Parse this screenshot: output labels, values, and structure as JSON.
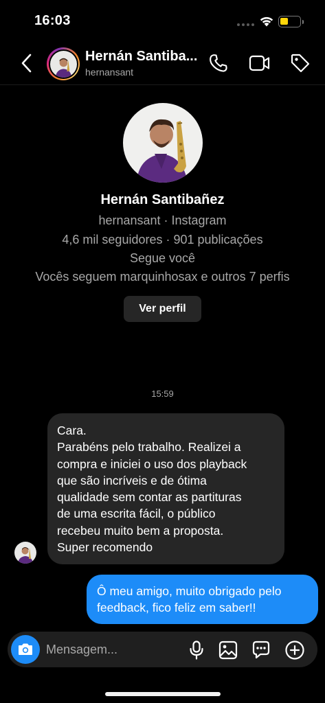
{
  "status_bar": {
    "time": "16:03",
    "battery_color": "#ffd60a"
  },
  "header": {
    "name": "Hernán Santiba...",
    "username": "hernansant",
    "icons": [
      "back-icon",
      "phone-icon",
      "video-icon",
      "tag-icon"
    ]
  },
  "profile": {
    "name": "Hernán Santibañez",
    "handle_line": "hernansant · Instagram",
    "stats_line": "4,6 mil seguidores · 901 publicações",
    "follows_you": "Segue você",
    "mutuals": "Vocês seguem marquinhosax e outros 7 perfis",
    "view_profile_label": "Ver perfil"
  },
  "conversation": {
    "timestamp": "15:59",
    "received_lines": [
      "Cara.",
      "Parabéns pelo trabalho. Realizei a",
      "compra e iniciei o uso dos playback",
      "que são incríveis e de ótima",
      "qualidade sem contar as partituras",
      "de uma escrita fácil, o público",
      "recebeu muito bem a proposta.",
      "Super recomendo"
    ],
    "sent_lines": [
      "Ô meu amigo, muito obrigado pelo",
      "feedback, fico feliz em saber!!"
    ],
    "bubble_colors": {
      "received": "#262626",
      "sent": "#1d8cf8"
    }
  },
  "composer": {
    "placeholder": "Mensagem...",
    "icons": [
      "camera-icon",
      "mic-icon",
      "gallery-icon",
      "sticker-icon",
      "plus-icon"
    ]
  }
}
